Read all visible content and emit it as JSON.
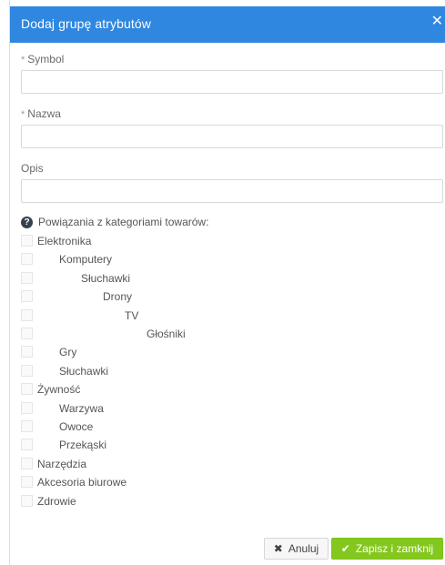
{
  "dialog": {
    "title": "Dodaj grupę atrybutów",
    "close_icon": "close-icon"
  },
  "form": {
    "required_marker": "*",
    "symbol_label": "Symbol",
    "symbol_value": "",
    "name_label": "Nazwa",
    "name_value": "",
    "description_label": "Opis",
    "description_value": ""
  },
  "associations": {
    "heading": "Powiązania z kategoriami towarów:",
    "help_icon": "?",
    "categories": [
      {
        "label": "Elektronika",
        "level": 0,
        "checked": false
      },
      {
        "label": "Komputery",
        "level": 1,
        "checked": false
      },
      {
        "label": "Słuchawki",
        "level": 2,
        "checked": false
      },
      {
        "label": "Drony",
        "level": 3,
        "checked": false
      },
      {
        "label": "TV",
        "level": 4,
        "checked": false
      },
      {
        "label": "Głośniki",
        "level": 5,
        "checked": false
      },
      {
        "label": "Gry",
        "level": 1,
        "checked": false
      },
      {
        "label": "Słuchawki",
        "level": 1,
        "checked": false
      },
      {
        "label": "Żywność",
        "level": 0,
        "checked": false
      },
      {
        "label": "Warzywa",
        "level": 1,
        "checked": false
      },
      {
        "label": "Owoce",
        "level": 1,
        "checked": false
      },
      {
        "label": "Przekąski",
        "level": 1,
        "checked": false
      },
      {
        "label": "Narzędzia",
        "level": 0,
        "checked": false
      },
      {
        "label": "Akcesoria biurowe",
        "level": 0,
        "checked": false
      },
      {
        "label": "Zdrowie",
        "level": 0,
        "checked": false
      }
    ]
  },
  "footer": {
    "cancel_icon": "✖",
    "cancel_label": "Anuluj",
    "save_icon": "✔",
    "save_label": "Zapisz i zamknij"
  },
  "colors": {
    "header": "#2f87e0",
    "save_button": "#84c71e"
  }
}
